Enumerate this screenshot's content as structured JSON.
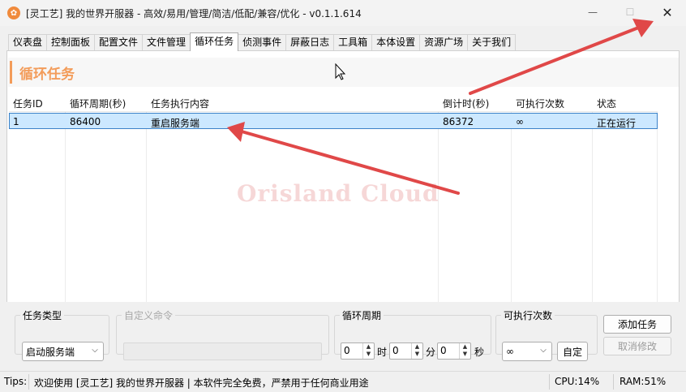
{
  "window": {
    "title": "[灵工艺] 我的世界开服器 - 高效/易用/管理/简洁/低配/兼容/优化 - v0.1.1.614",
    "icon": "app-logo-icon",
    "minimize_glyph": "—",
    "maximize_glyph": "☐",
    "close_glyph": "✕"
  },
  "tabs": [
    {
      "label": "仪表盘"
    },
    {
      "label": "控制面板"
    },
    {
      "label": "配置文件"
    },
    {
      "label": "文件管理"
    },
    {
      "label": "循环任务",
      "active": true
    },
    {
      "label": "侦测事件"
    },
    {
      "label": "屏蔽日志"
    },
    {
      "label": "工具箱"
    },
    {
      "label": "本体设置"
    },
    {
      "label": "资源广场"
    },
    {
      "label": "关于我们"
    }
  ],
  "section": {
    "title": "循环任务",
    "accent_color": "#f39c5a"
  },
  "table": {
    "columns": [
      "任务ID",
      "循环周期(秒)",
      "任务执行内容",
      "倒计时(秒)",
      "可执行次数",
      "状态"
    ],
    "rows": [
      [
        "1",
        "86400",
        "重启服务端",
        "86372",
        "∞",
        "正在运行"
      ]
    ]
  },
  "watermark": "Orisland Cloud",
  "form": {
    "task_type": {
      "legend": "任务类型",
      "value": "启动服务端"
    },
    "custom_command": {
      "legend": "自定义命令",
      "value": ""
    },
    "cycle": {
      "legend": "循环周期",
      "hours": "0",
      "hours_unit": "时",
      "minutes": "0",
      "minutes_unit": "分",
      "seconds": "0",
      "seconds_unit": "秒"
    },
    "exec_count": {
      "legend": "可执行次数",
      "value": "∞",
      "custom_label": "自定"
    },
    "add_button": "添加任务",
    "cancel_button": "取消修改"
  },
  "statusbar": {
    "tips_label": "Tips:",
    "message": "欢迎使用 [灵工艺] 我的世界开服器 | 本软件完全免费，严禁用于任何商业用途",
    "cpu": "CPU:14%",
    "ram": "RAM:51%"
  },
  "annotation_color": "#e04848"
}
